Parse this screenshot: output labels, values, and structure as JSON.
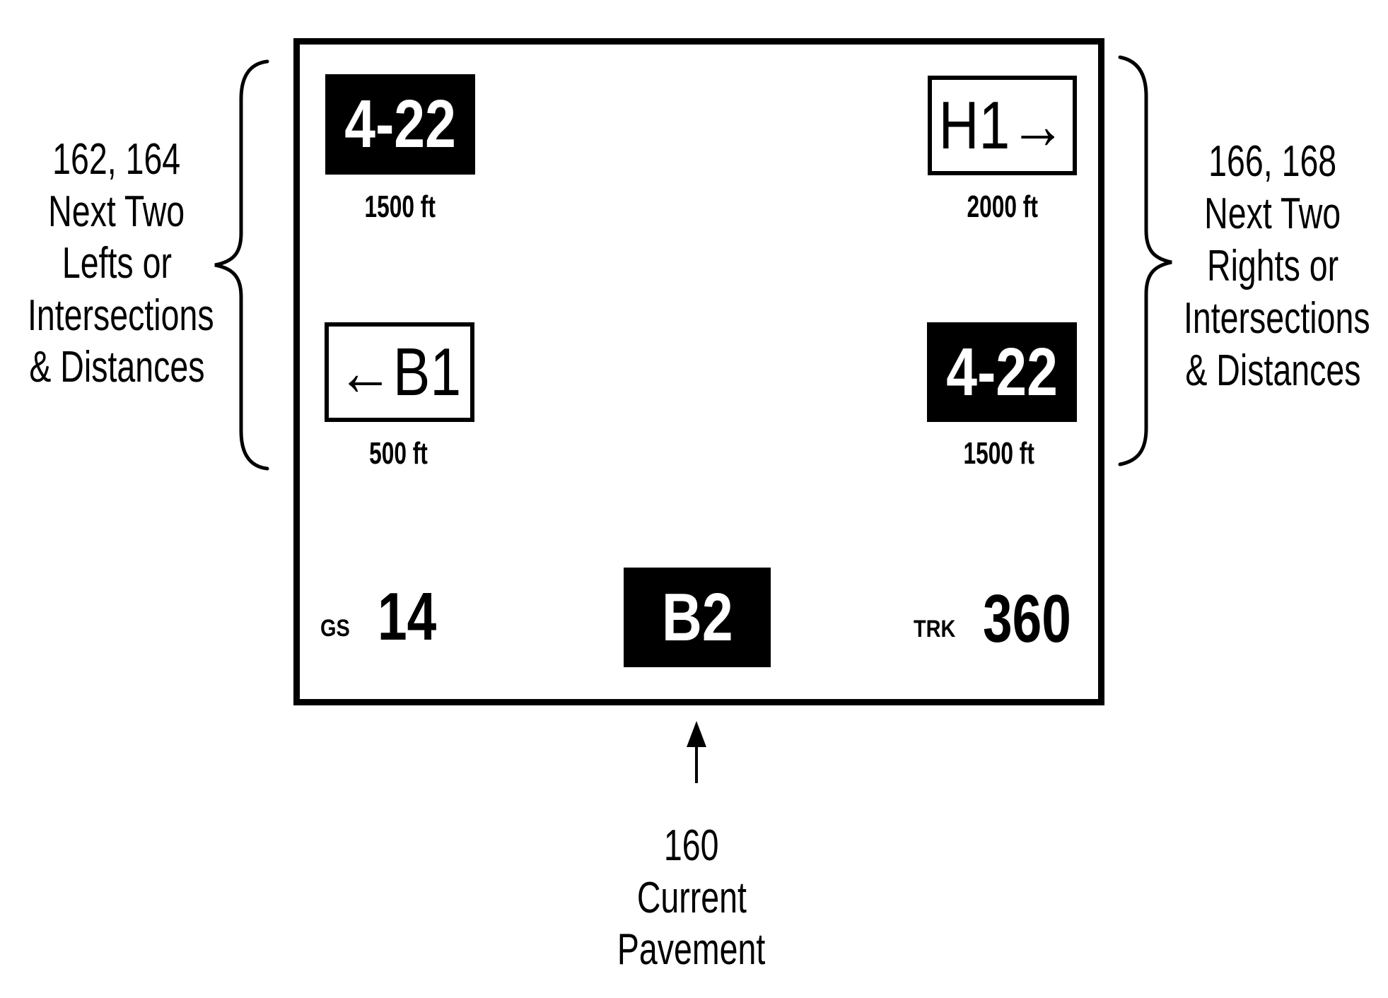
{
  "display": {
    "left_signs": [
      {
        "id": "162",
        "label": "4-22",
        "style": "dark",
        "distance": "1500 ft"
      },
      {
        "id": "164",
        "label": "←B1",
        "style": "boxed",
        "distance": "500 ft"
      }
    ],
    "right_signs": [
      {
        "id": "166",
        "label": "H1→",
        "style": "boxed",
        "distance": "2000 ft"
      },
      {
        "id": "168",
        "label": "4-22",
        "style": "dark",
        "distance": "1500 ft"
      }
    ],
    "current_pavement": {
      "label": "B2",
      "style": "dark"
    },
    "ground_speed": {
      "label": "GS",
      "value": "14"
    },
    "track": {
      "label": "TRK",
      "value": "360"
    }
  },
  "callouts": {
    "left": {
      "lines": [
        "162, 164",
        "Next Two",
        "Lefts or",
        "Intersections",
        "& Distances"
      ]
    },
    "right": {
      "lines": [
        "166, 168",
        "Next Two",
        "Rights or",
        "Intersections",
        "& Distances"
      ]
    },
    "bottom": {
      "lines": [
        "160",
        "Current",
        "Pavement"
      ]
    }
  },
  "icons": {
    "left_brace": "left-curly-brace",
    "right_brace": "right-curly-brace",
    "pointer_arrow": "up-arrow"
  },
  "colors": {
    "ink": "#000000",
    "paper": "#ffffff"
  }
}
